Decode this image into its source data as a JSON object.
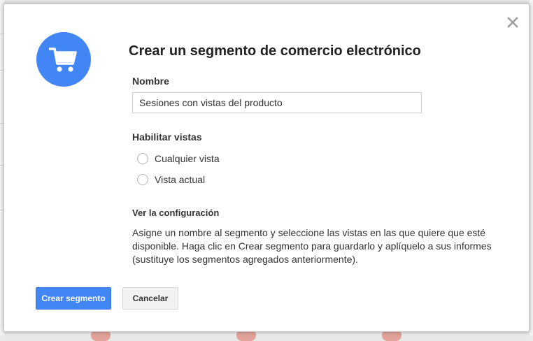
{
  "dialog": {
    "title": "Crear un segmento de comercio electrónico",
    "close_icon": "close-icon",
    "header_icon": "shopping-cart-icon",
    "accent_color": "#4285f4"
  },
  "name_field": {
    "label": "Nombre",
    "value": "Sesiones con vistas del producto"
  },
  "views": {
    "label": "Habilitar vistas",
    "options": [
      {
        "label": "Cualquier vista",
        "selected": false
      },
      {
        "label": "Vista actual",
        "selected": false
      }
    ]
  },
  "config": {
    "heading": "Ver la configuración",
    "description": "Asigne un nombre al segmento y seleccione las vistas en las que quiere que esté disponible. Haga clic en Crear segmento para guardarlo y aplíquelo a sus informes (sustituye los segmentos agregados anteriormente)."
  },
  "buttons": {
    "create": "Crear segmento",
    "cancel": "Cancelar"
  }
}
